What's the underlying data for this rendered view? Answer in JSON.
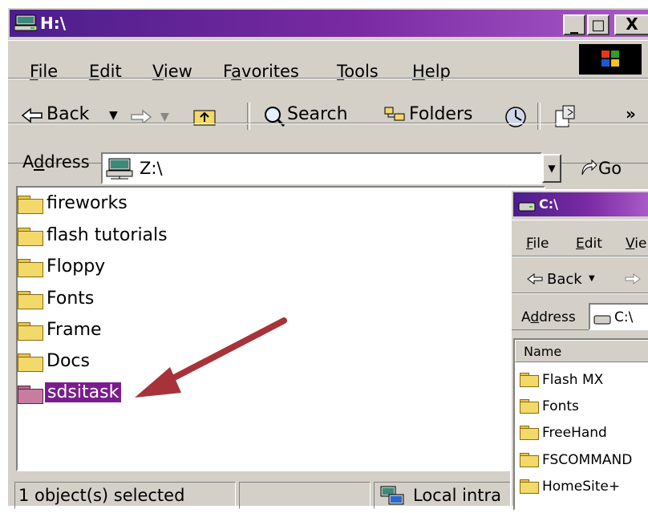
{
  "main_window": {
    "title": "H:\\",
    "caption_buttons": [
      "_",
      "□",
      "X"
    ],
    "menu": [
      {
        "key": "F",
        "rest": "ile"
      },
      {
        "key": "E",
        "rest": "dit"
      },
      {
        "key": "V",
        "rest": "iew"
      },
      {
        "pre": "F",
        "key": "a",
        "rest": "vorites"
      },
      {
        "key": "T",
        "rest": "ools"
      },
      {
        "key": "H",
        "rest": "elp"
      }
    ],
    "toolbar": {
      "back_label": "Back",
      "search_label": "Search",
      "folders_label": "Folders",
      "more": "»"
    },
    "address": {
      "label_pre": "A",
      "label_key": "d",
      "label_rest": "dress",
      "value": "Z:\\",
      "go_label": "Go"
    },
    "folders": [
      {
        "name": "fireworks"
      },
      {
        "name": "flash tutorials"
      },
      {
        "name": "Floppy"
      },
      {
        "name": "Fonts"
      },
      {
        "name": "Frame"
      },
      {
        "name": "Docs"
      },
      {
        "name": "sdsitask",
        "selected": true
      }
    ],
    "status": {
      "selection": "1 object(s) selected",
      "zone": "Local intra"
    }
  },
  "second_window": {
    "title": "C:\\",
    "menu": [
      {
        "key": "F",
        "rest": "ile"
      },
      {
        "key": "E",
        "rest": "dit"
      },
      {
        "key": "V",
        "rest": "ie"
      }
    ],
    "back_label": "Back",
    "address_label_pre": "A",
    "address_label_key": "d",
    "address_label_rest": "dress",
    "address_value": "C:\\",
    "column_header": "Name",
    "folders": [
      "Flash MX",
      "Fonts",
      "FreeHand",
      "FSCOMMAND",
      "HomeSite+"
    ]
  },
  "colors": {
    "title_start": "#4b1e8c",
    "title_end": "#a85bc8",
    "selection": "#7a1d8c",
    "arrow": "#a8323a"
  }
}
